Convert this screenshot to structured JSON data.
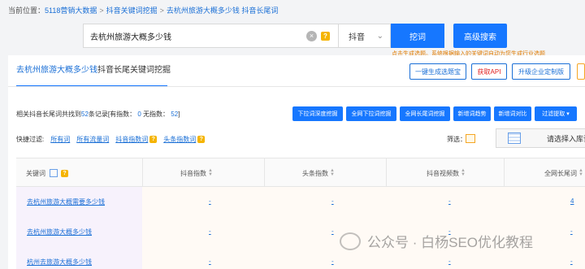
{
  "breadcrumb": {
    "prefix": "当前位置：",
    "items": [
      "5118营销大数据",
      "抖音关键词挖掘",
      "去杭州旅游大概多少钱 抖音长尾词"
    ]
  },
  "search": {
    "value": "去杭州旅游大概多少钱",
    "platform": "抖音",
    "dig_button": "挖词",
    "advanced_button": "高级搜索",
    "tip": "点击生成选题。系统根据输入的关键词自动为您生成行业选题"
  },
  "tabs": {
    "active": "去杭州旅游大概多少钱",
    "rest": "抖音长尾关键词挖掘"
  },
  "top_buttons": {
    "topic": "一键生成选题宝",
    "api": "获取API",
    "upgrade": "升级企业定制版"
  },
  "summary": {
    "pre": "相关抖音长尾词共找到",
    "total": "52",
    "mid": "条记录[有指数：",
    "with_index": "0",
    "mid2": "无指数：",
    "without_index": "52",
    "post": "]"
  },
  "action_buttons": [
    "下拉词深度挖掘",
    "全网下拉词挖掘",
    "全网长尾词挖掘",
    "新增词趋势",
    "新增词对比",
    "过滤提取"
  ],
  "filters": {
    "label": "快捷过滤:",
    "items": [
      "所有词",
      "所有流量词",
      "抖音指数词",
      "头条指数词"
    ]
  },
  "screen_label": "筛选：",
  "library_placeholder": "请选择入库词",
  "table": {
    "columns": [
      "关键词",
      "抖音指数",
      "头条指数",
      "抖音视频数",
      "全网长尾词"
    ],
    "rows": [
      {
        "keyword": "去杭州旅游大概需要多少钱",
        "douyin": "-",
        "toutiao": "-",
        "videos": "-",
        "longtail": "4"
      },
      {
        "keyword": "去杭州旅游大概多少钱",
        "douyin": "-",
        "toutiao": "-",
        "videos": "-",
        "longtail": "-"
      },
      {
        "keyword": "杭州去旅游大概多少钱",
        "douyin": "-",
        "toutiao": "-",
        "videos": "-",
        "longtail": "-"
      }
    ]
  },
  "watermark": "公众号 · 白杨SEO优化教程"
}
